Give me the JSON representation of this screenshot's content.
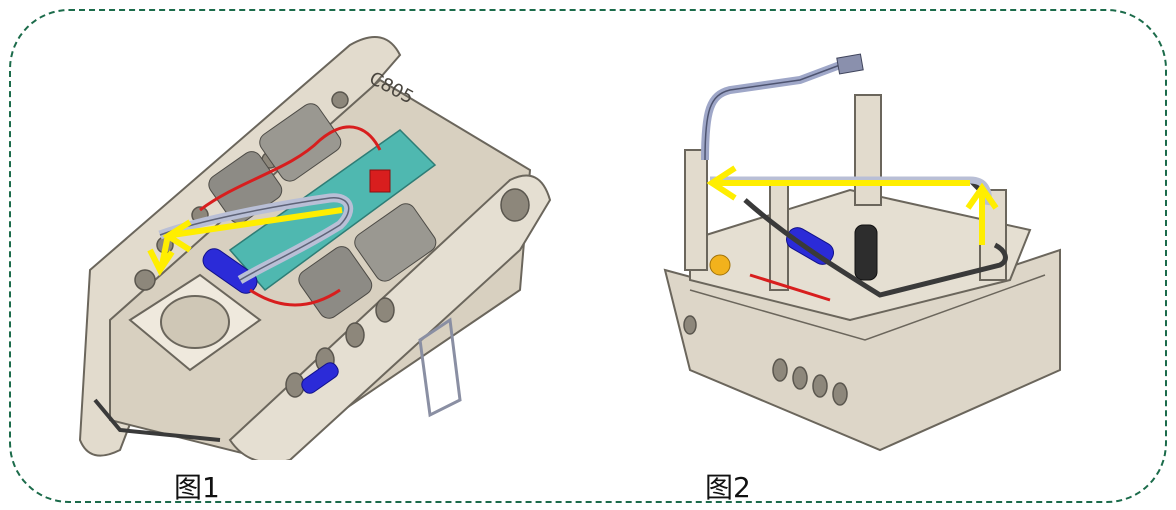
{
  "captions": {
    "figure1": "图1",
    "figure2": "图2"
  },
  "figure1": {
    "part_marking": "C805"
  },
  "colors": {
    "frame_border": "#1b6b4a",
    "housing": "#ddd6c8",
    "housing_edge": "#6b665c",
    "arrow": "#ffee00",
    "pcb": "#4fb8b0",
    "wire_red": "#d81e1e",
    "motor_blue": "#2b2bd8",
    "cable_dark": "#3a3a3a"
  }
}
